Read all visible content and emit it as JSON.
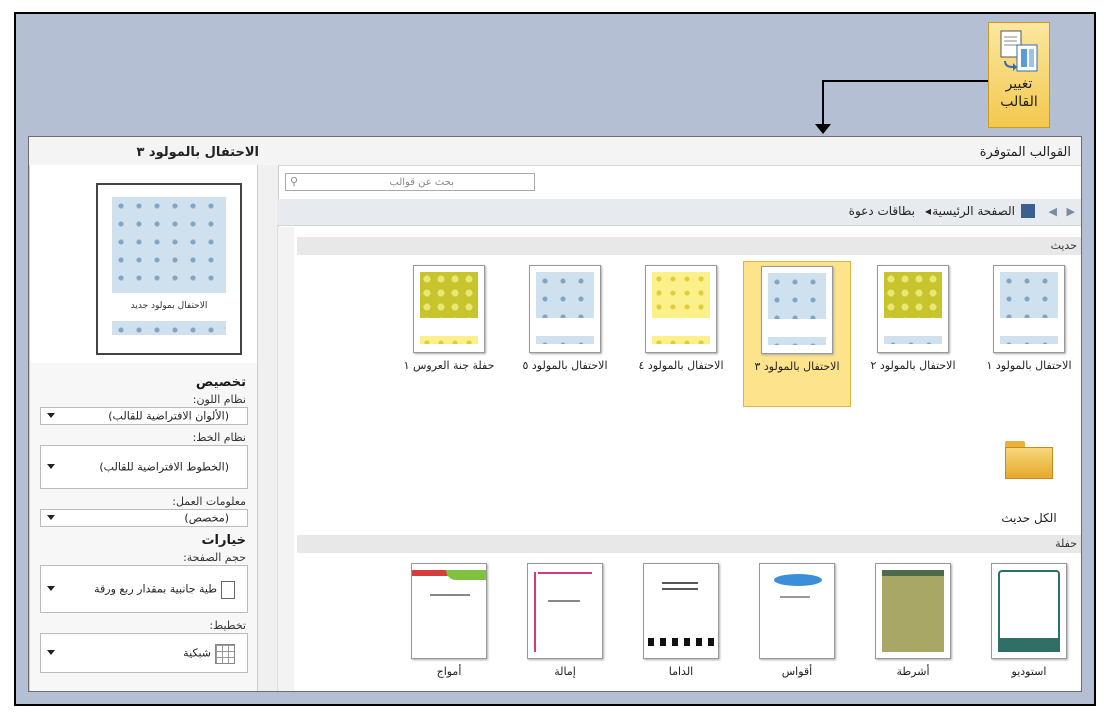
{
  "ribbon": {
    "button_label_line1": "تغيير",
    "button_label_line2": "القالب"
  },
  "window": {
    "main_title": "القوالب المتوفرة",
    "side_title": "الاحتفال بالمولود ٣",
    "search_placeholder": "بحث عن قوالب",
    "breadcrumb": {
      "home": "الصفحة الرئيسية",
      "separator": "◂",
      "current": "بطاقات دعوة"
    }
  },
  "preview": {
    "caption": "الاحتفال بمولود جديد"
  },
  "customize": {
    "heading": "تخصيص",
    "color_label": "نظام اللون:",
    "color_value": "(الألوان الافتراضية للقالب)",
    "font_label": "نظام الخط:",
    "font_value": "(الخطوط الافتراضية للقالب)",
    "business_label": "معلومات العمل:",
    "business_value": "(مخصص)"
  },
  "options": {
    "heading": "خيارات",
    "page_size_label": "حجم الصفحة:",
    "page_size_value": "طية جانبية بمقدار ربع ورقة",
    "layout_label": "تخطيط:",
    "layout_value": "شبكية"
  },
  "sections": {
    "new": {
      "label": "حديث",
      "tiles": [
        {
          "label": "الاحتفال بالمولود ١",
          "pattern": "blue"
        },
        {
          "label": "الاحتفال بالمولود ٢",
          "pattern": "yg"
        },
        {
          "label": "الاحتفال بالمولود ٣",
          "pattern": "blue",
          "selected": true
        },
        {
          "label": "الاحتفال بالمولود ٤",
          "pattern": "yellow"
        },
        {
          "label": "الاحتفال بالمولود ٥",
          "pattern": "blue"
        },
        {
          "label": "حفلة جنة العروس ١",
          "pattern": "yg"
        }
      ],
      "all_label": "الكل حديث"
    },
    "party": {
      "label": "حفلة",
      "tiles": [
        {
          "label": "استوديو"
        },
        {
          "label": "أشرطة"
        },
        {
          "label": "أقواس"
        },
        {
          "label": "الداما"
        },
        {
          "label": "إمالة"
        },
        {
          "label": "أمواج"
        }
      ]
    }
  },
  "colors": {
    "accent_selected": "#fde38c",
    "frame_bg": "#b5bfd4"
  }
}
